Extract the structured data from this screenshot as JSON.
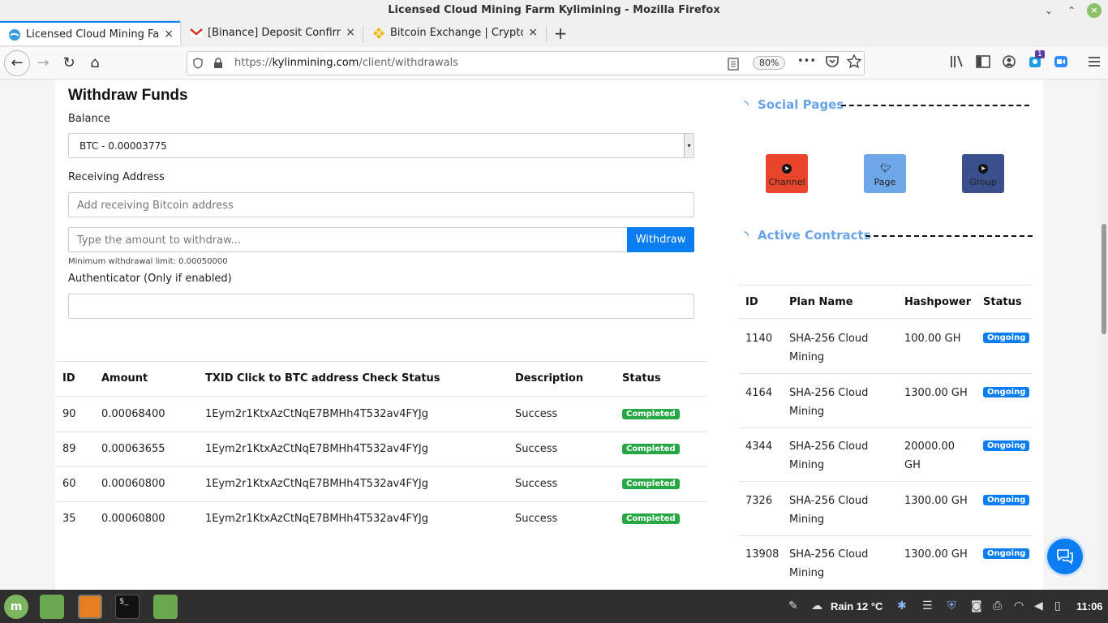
{
  "window": {
    "title": "Licensed Cloud Mining Farm Kylimining - Mozilla Firefox",
    "controls": {
      "minimize": "⌄",
      "maximize": "⌃",
      "close": "×"
    }
  },
  "tabs": [
    {
      "label": "Licensed Cloud Mining Farm",
      "icon": "globe-icon",
      "active": true
    },
    {
      "label": "[Binance] Deposit Confirme",
      "icon": "gmail-icon",
      "active": false
    },
    {
      "label": "Bitcoin Exchange | Cryptoc",
      "icon": "binance-icon",
      "active": false
    }
  ],
  "tab_close": "×",
  "new_tab": "+",
  "nav": {
    "url_prefix": "https://",
    "url_domain": "kylinmining.com",
    "url_path": "/client/withdrawals",
    "zoom": "80%",
    "back": "←",
    "forward": "→",
    "reload": "↻",
    "home": "⌂",
    "more": "•••"
  },
  "withdraw": {
    "heading": "Withdraw Funds",
    "balance_label": "Balance",
    "balance_value": "BTC - 0.00003775",
    "receiving_label": "Receiving Address",
    "receiving_placeholder": "Add receiving Bitcoin address",
    "amount_placeholder": "Type the amount to withdraw...",
    "withdraw_button": "Withdraw",
    "min_limit": "Minimum withdrawal limit: 0.00050000",
    "auth_label": "Authenticator (Only if enabled)",
    "auth_value": ""
  },
  "withdrawals_table": {
    "headers": [
      "ID",
      "Amount",
      "TXID Click to BTC address Check Status",
      "Description",
      "Status"
    ],
    "rows": [
      {
        "id": "90",
        "amount": "0.00068400",
        "txid": "1Eym2r1KtxAzCtNqE7BMHh4T532av4FYJg",
        "description": "Success",
        "status": "Completed"
      },
      {
        "id": "89",
        "amount": "0.00063655",
        "txid": "1Eym2r1KtxAzCtNqE7BMHh4T532av4FYJg",
        "description": "Success",
        "status": "Completed"
      },
      {
        "id": "60",
        "amount": "0.00060800",
        "txid": "1Eym2r1KtxAzCtNqE7BMHh4T532av4FYJg",
        "description": "Success",
        "status": "Completed"
      },
      {
        "id": "35",
        "amount": "0.00060800",
        "txid": "1Eym2r1KtxAzCtNqE7BMHh4T532av4FYJg",
        "description": "Success",
        "status": "Completed"
      }
    ]
  },
  "social": {
    "heading": "Social Pages",
    "buttons": [
      {
        "label": "Channel",
        "icon": "telegram-icon",
        "color": "#e8452c"
      },
      {
        "label": "Page",
        "icon": "twitter-icon",
        "color": "#6fa8e8"
      },
      {
        "label": "Group",
        "icon": "telegram-icon",
        "color": "#3a4f8c"
      }
    ]
  },
  "contracts": {
    "heading": "Active Contracts",
    "headers": [
      "ID",
      "Plan Name",
      "Hashpower",
      "Status"
    ],
    "rows": [
      {
        "id": "1140",
        "plan_line1": "SHA-256 Cloud",
        "plan_line2": "Mining",
        "hash_line1": "100.00 GH",
        "hash_line2": "",
        "status": "Ongoing"
      },
      {
        "id": "4164",
        "plan_line1": "SHA-256 Cloud",
        "plan_line2": "Mining",
        "hash_line1": "1300.00 GH",
        "hash_line2": "",
        "status": "Ongoing"
      },
      {
        "id": "4344",
        "plan_line1": "SHA-256 Cloud",
        "plan_line2": "Mining",
        "hash_line1": "20000.00",
        "hash_line2": "GH",
        "status": "Ongoing"
      },
      {
        "id": "7326",
        "plan_line1": "SHA-256 Cloud",
        "plan_line2": "Mining",
        "hash_line1": "1300.00 GH",
        "hash_line2": "",
        "status": "Ongoing"
      },
      {
        "id": "13908",
        "plan_line1": "SHA-256 Cloud",
        "plan_line2": "Mining",
        "hash_line1": "1300.00 GH",
        "hash_line2": "",
        "status": "Ongoing"
      }
    ]
  },
  "taskbar": {
    "weather": "Rain 12 °C",
    "time": "11:06",
    "notification_count": "1"
  },
  "colors": {
    "accent": "#0a7df0",
    "success": "#28a745",
    "heading_blue": "#6aa4e8"
  }
}
